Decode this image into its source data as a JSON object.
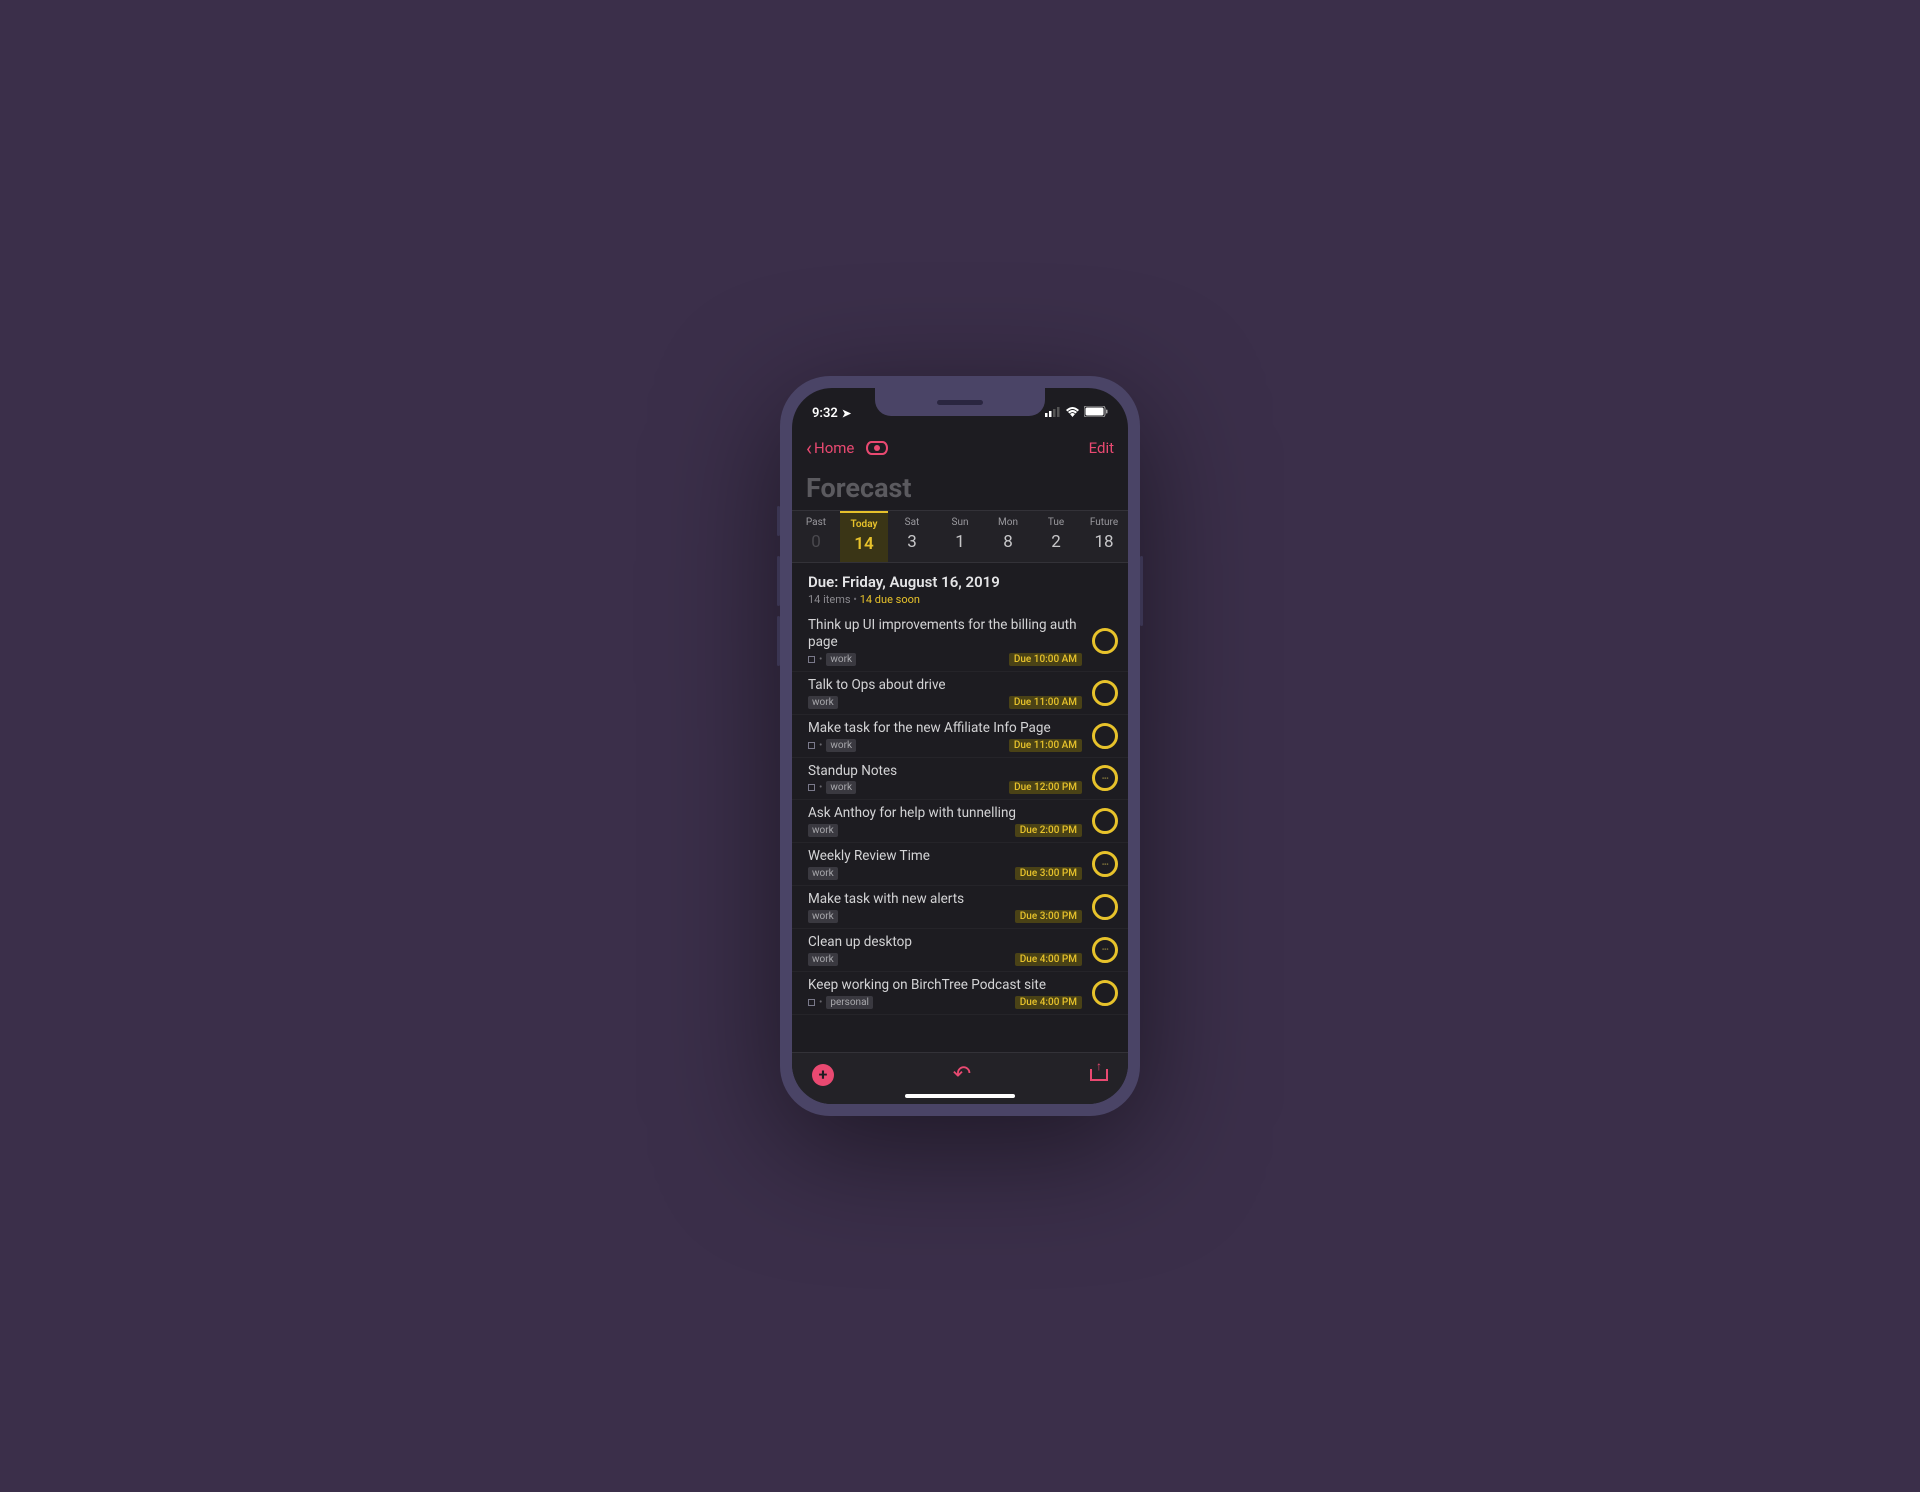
{
  "status": {
    "time": "9:32",
    "location_indicator": "➤"
  },
  "nav": {
    "back_label": "Home",
    "edit_label": "Edit"
  },
  "title": "Forecast",
  "days": [
    {
      "label": "Past",
      "count": "0",
      "kind": "past"
    },
    {
      "label": "Today",
      "count": "14",
      "kind": "today"
    },
    {
      "label": "Sat",
      "count": "3",
      "kind": ""
    },
    {
      "label": "Sun",
      "count": "1",
      "kind": ""
    },
    {
      "label": "Mon",
      "count": "8",
      "kind": ""
    },
    {
      "label": "Tue",
      "count": "2",
      "kind": ""
    },
    {
      "label": "Future",
      "count": "18",
      "kind": ""
    }
  ],
  "due": {
    "heading": "Due: Friday, August 16, 2019",
    "items_text": "14 items",
    "due_soon_text": "14 due soon"
  },
  "tasks": [
    {
      "title": "Think up UI improvements for the billing auth page",
      "flag": true,
      "tag": "work",
      "due": "Due 10:00 AM",
      "dots": false
    },
    {
      "title": "Talk to Ops about drive",
      "flag": false,
      "tag": "work",
      "due": "Due 11:00 AM",
      "dots": false
    },
    {
      "title": "Make task for the new Affiliate Info Page",
      "flag": true,
      "tag": "work",
      "due": "Due 11:00 AM",
      "dots": false
    },
    {
      "title": "Standup Notes",
      "flag": true,
      "tag": "work",
      "due": "Due 12:00 PM",
      "dots": true
    },
    {
      "title": "Ask Anthoy for help with tunnelling",
      "flag": false,
      "tag": "work",
      "due": "Due 2:00 PM",
      "dots": false
    },
    {
      "title": "Weekly Review Time",
      "flag": false,
      "tag": "work",
      "due": "Due 3:00 PM",
      "dots": true
    },
    {
      "title": "Make task with new alerts",
      "flag": false,
      "tag": "work",
      "due": "Due 3:00 PM",
      "dots": false
    },
    {
      "title": "Clean up desktop",
      "flag": false,
      "tag": "work",
      "due": "Due 4:00 PM",
      "dots": true
    },
    {
      "title": "Keep working on BirchTree Podcast site",
      "flag": true,
      "tag": "personal",
      "due": "Due 4:00 PM",
      "dots": false
    }
  ],
  "colors": {
    "accent": "#e94971",
    "warn": "#e7c22b",
    "bg": "#1d1c21"
  }
}
